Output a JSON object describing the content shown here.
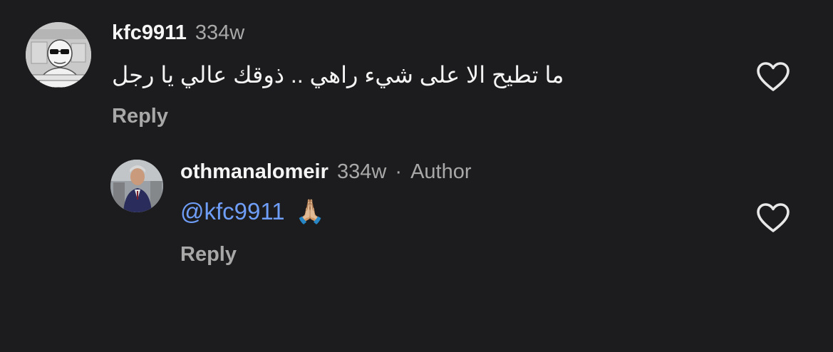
{
  "comments": [
    {
      "username": "kfc9911",
      "time": "334w",
      "text": "ما تطيح الا على شيء راهي .. ذوقك عالي يا رجل",
      "reply_label": "Reply",
      "avatar_icon": "family-guy-avatar"
    },
    {
      "username": "othmanalomeir",
      "time": "334w",
      "separator": "·",
      "author_label": "Author",
      "mention": "@kfc9911",
      "emoji": "🙏🏼",
      "reply_label": "Reply",
      "avatar_icon": "man-in-suit-avatar"
    }
  ],
  "icons": {
    "like": "heart-outline-icon"
  },
  "colors": {
    "background": "#1c1c1e",
    "text": "#f5f5f5",
    "secondary": "#a8a8a8",
    "mention": "#6f9ef8"
  }
}
